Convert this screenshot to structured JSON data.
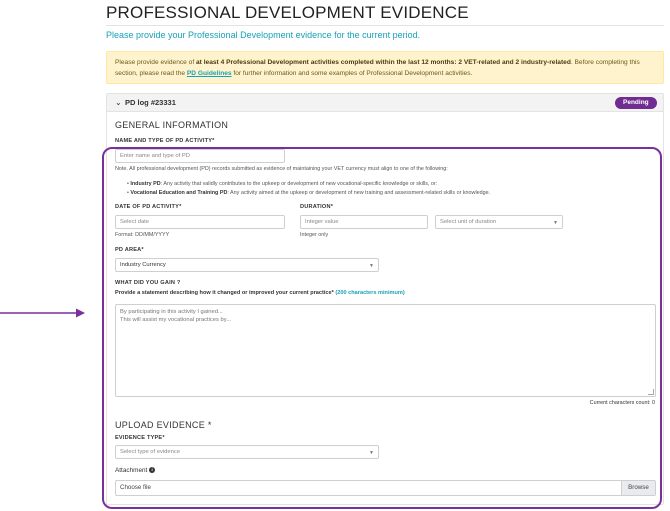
{
  "page": {
    "title": "PROFESSIONAL DEVELOPMENT EVIDENCE",
    "subtitle": "Please provide your Professional Development evidence for the current period.",
    "alert": {
      "part1": "Please provide evidence of ",
      "bold": "at least 4 Professional Development activities completed within the last 12 months: 2 VET-related and 2 industry-related",
      "part2": ". Before completing this section, please read the ",
      "link": "PD Guidelines",
      "part3": " for further information and some examples of Professional Development activities."
    }
  },
  "log": {
    "title": "PD log #23331",
    "status": "Pending",
    "status_color": "#6f2c91"
  },
  "general": {
    "heading": "GENERAL INFORMATION",
    "name_label": "NAME AND TYPE OF PD ACTIVITY*",
    "name_placeholder": "Enter name and type of PD",
    "note": "Note. All professional development (PD) records submitted as evidence of maintaining your VET currency must align to one of the following:",
    "bullet1_bold": "Industry PD",
    "bullet1_text": ": Any activity that validly contributes to the upkeep or development of new vocational-specific knowledge or skills, or:",
    "bullet2_bold": "Vocational Education and Training PD",
    "bullet2_text": ": Any activity aimed at the upkeep or development of new training and assessment-related skills or knowledge.",
    "date_label": "DATE OF PD ACTIVITY*",
    "date_placeholder": "Select date",
    "date_format": "Format: DD/MM/YYYY",
    "duration_label": "DURATION*",
    "duration_placeholder": "Integer value",
    "duration_hint": "Integer only",
    "duration_unit_placeholder": "Select unit of duration",
    "area_label": "PD AREA*",
    "area_value": "Industry Currency",
    "gain_label": "WHAT DID YOU GAIN ?",
    "gain_prompt": "Provide a statement describing how it changed or improved your current practice*",
    "gain_min": " (200 characters minimum)",
    "gain_line1": "By participating in this activity I gained...",
    "gain_line2": "This will assist my vocational practices by...",
    "char_count": "Current characters count: 0"
  },
  "upload": {
    "heading": "UPLOAD EVIDENCE *",
    "type_label": "EVIDENCE TYPE*",
    "type_placeholder": "Select type of evidence",
    "attachment_label": "Attachment",
    "choose_file": "Choose file",
    "browse": "Browse"
  },
  "colors": {
    "accent": "#17a2b8",
    "highlight": "#7a2f9b",
    "alert_bg": "#fff3cd"
  }
}
